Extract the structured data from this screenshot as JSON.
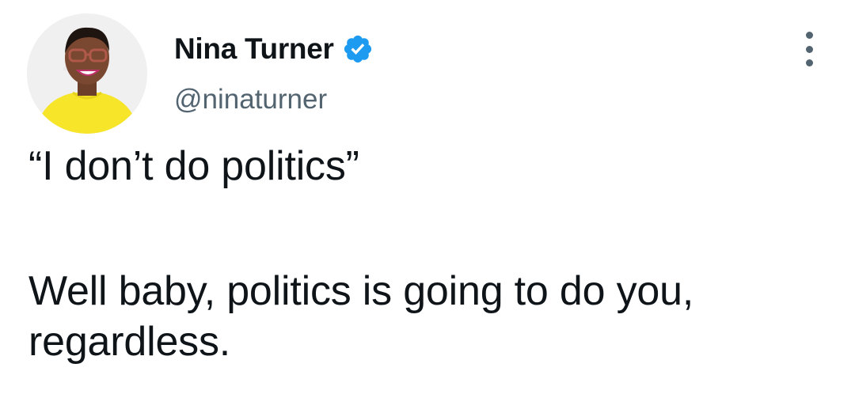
{
  "author": {
    "display_name": "Nina Turner",
    "handle": "@ninaturner",
    "verified": true,
    "verified_color": "#1d9bf0"
  },
  "avatar": {
    "icon": "profile-photo",
    "shirt_color": "#f7e52a"
  },
  "menu": {
    "icon": "more-options-icon"
  },
  "tweet": {
    "line1": "“I don’t do politics”",
    "line2": "Well baby, politics is going to do you,",
    "line3": "regardless."
  }
}
